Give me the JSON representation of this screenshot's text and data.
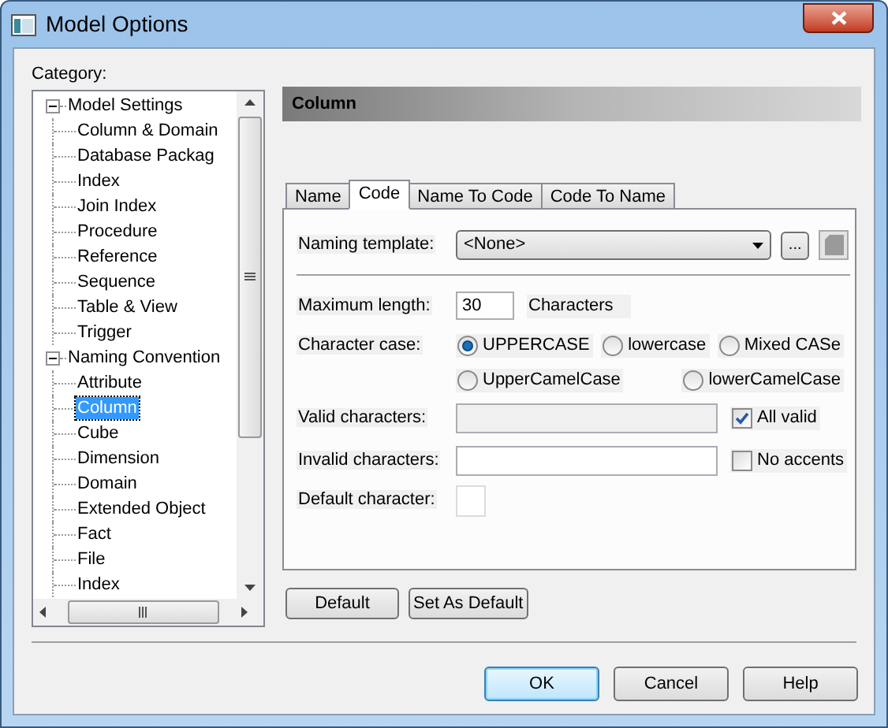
{
  "window": {
    "title": "Model Options"
  },
  "category_label": "Category:",
  "tree": [
    {
      "label": "Model Settings",
      "expanded": true,
      "children": [
        {
          "label": "Column & Domain",
          "selected": false
        },
        {
          "label": "Database Packag",
          "selected": false
        },
        {
          "label": "Index",
          "selected": false
        },
        {
          "label": "Join Index",
          "selected": false
        },
        {
          "label": "Procedure",
          "selected": false
        },
        {
          "label": "Reference",
          "selected": false
        },
        {
          "label": "Sequence",
          "selected": false
        },
        {
          "label": "Table & View",
          "selected": false
        },
        {
          "label": "Trigger",
          "selected": false
        }
      ]
    },
    {
      "label": "Naming Convention",
      "expanded": true,
      "children": [
        {
          "label": "Attribute",
          "selected": false
        },
        {
          "label": "Column",
          "selected": true
        },
        {
          "label": "Cube",
          "selected": false
        },
        {
          "label": "Dimension",
          "selected": false
        },
        {
          "label": "Domain",
          "selected": false
        },
        {
          "label": "Extended Object",
          "selected": false
        },
        {
          "label": "Fact",
          "selected": false
        },
        {
          "label": "File",
          "selected": false
        },
        {
          "label": "Index",
          "selected": false
        }
      ]
    }
  ],
  "header": "Column",
  "tabs": [
    {
      "label": "Name",
      "selected": false
    },
    {
      "label": "Code",
      "selected": true
    },
    {
      "label": "Name To Code",
      "selected": false
    },
    {
      "label": "Code To Name",
      "selected": false
    }
  ],
  "naming_template": {
    "label": "Naming template:",
    "value": "<None>",
    "browse": "..."
  },
  "maximum_length": {
    "label": "Maximum length:",
    "value": "30",
    "unit": "Characters"
  },
  "character_case": {
    "label": "Character case:",
    "options": [
      {
        "label": "UPPERCASE",
        "selected": true
      },
      {
        "label": "lowercase",
        "selected": false
      },
      {
        "label": "Mixed CASe",
        "selected": false
      },
      {
        "label": "UpperCamelCase",
        "selected": false
      },
      {
        "label": "lowerCamelCase",
        "selected": false
      }
    ]
  },
  "valid_characters": {
    "label": "Valid characters:",
    "disabled": true,
    "option": {
      "label": "All valid",
      "checked": true
    }
  },
  "invalid_characters": {
    "label": "Invalid characters:",
    "disabled": false,
    "option": {
      "label": "No accents",
      "checked": false
    }
  },
  "default_character": {
    "label": "Default character:"
  },
  "panel_buttons": [
    "Default",
    "Set As Default"
  ],
  "dialog_buttons": [
    {
      "label": "OK",
      "default": true
    },
    {
      "label": "Cancel",
      "default": false
    },
    {
      "label": "Help",
      "default": false
    }
  ]
}
